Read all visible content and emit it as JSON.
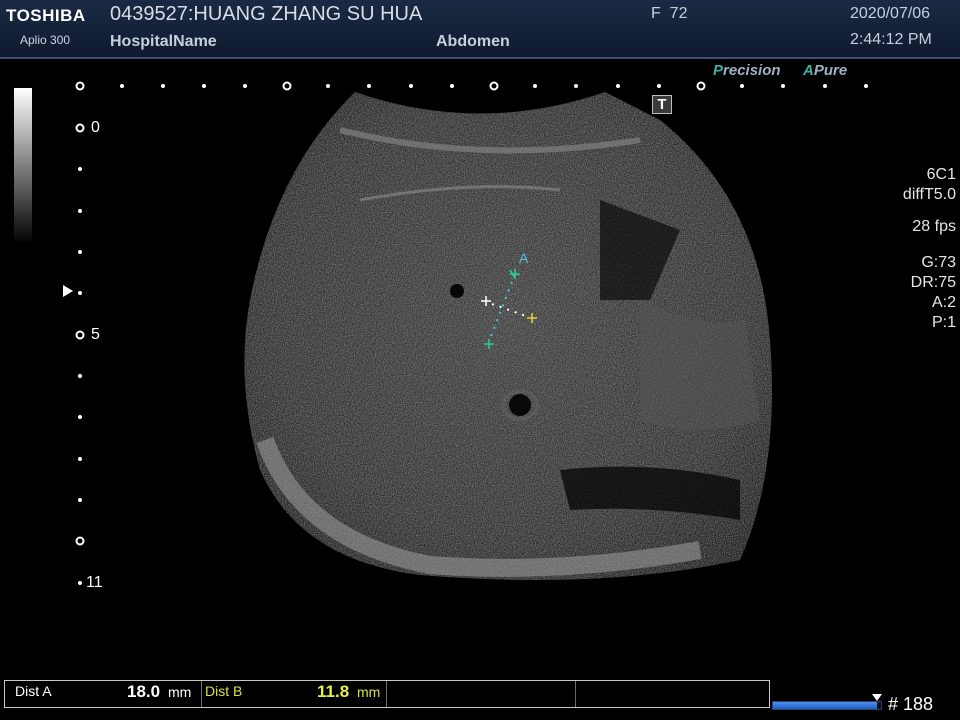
{
  "header": {
    "brand": "TOSHIBA",
    "model": "Aplio 300",
    "patient": "0439527:HUANG ZHANG SU HUA",
    "hospital": "HospitalName",
    "frame_info": "F  72",
    "preset": "Abdomen",
    "date": "2020/07/06",
    "time": "2:44:12 PM"
  },
  "tags": {
    "precision_first": "P",
    "precision_rest": "recision",
    "apure_first": "A",
    "apure_rest": "Pure"
  },
  "t_button": {
    "label": "T",
    "icon": "text-annotation-icon"
  },
  "depth_scale": {
    "labels": [
      "0",
      "5",
      "11"
    ]
  },
  "params": {
    "probe": "6C1",
    "mode": "diffT5.0",
    "fps": "28 fps",
    "gain": "G:73",
    "dynamic_range": "DR:75",
    "a": "A:2",
    "p": "P:1"
  },
  "caliper": {
    "label": "A"
  },
  "measurements": {
    "dist_a_label": "Dist A",
    "dist_a_value": "18.0",
    "dist_a_unit": "mm",
    "dist_b_label": "Dist B",
    "dist_b_value": "11.8",
    "dist_b_unit": "mm"
  },
  "cine": {
    "progress_fraction": 0.96,
    "frame_count": "# 188"
  },
  "colors": {
    "header_bg": "#14223b",
    "caliper_green": "#27d29a",
    "caliper_cyan": "#46c7e8",
    "caliper_yellow": "#e2d23a",
    "dist_b_color": "#d8e04a",
    "progress_blue": "#2f6fdb"
  }
}
